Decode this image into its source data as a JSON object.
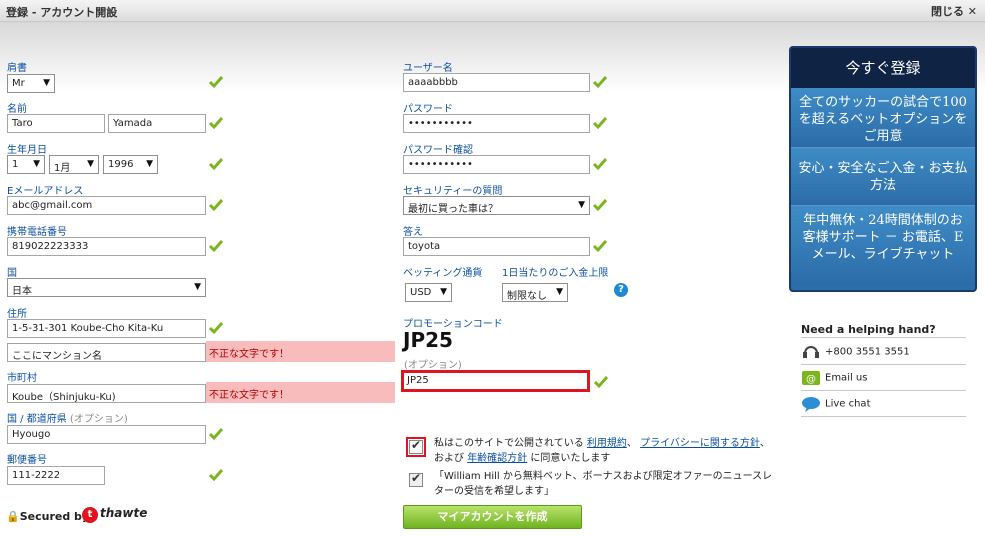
{
  "window": {
    "title": "登録 - アカウント開設",
    "close_label": "閉じる"
  },
  "colors": {
    "label": "#0b4fa3",
    "check": "#7ab51d",
    "error_bg": "#f9bcbc",
    "highlight": "#e0141e",
    "panel": "#2a6fa8"
  },
  "form": {
    "title_label": "肩書",
    "title_value": "Mr",
    "name_label": "名前",
    "first_name": "Taro",
    "last_name": "Yamada",
    "dob_label": "生年月日",
    "dob_day": "1",
    "dob_month": "1月",
    "dob_year": "1996",
    "email_label": "Eメールアドレス",
    "email": "abc@gmail.com",
    "mobile_label": "携帯電話番号",
    "mobile": "819022223333",
    "country_label": "国",
    "country": "日本",
    "address_label": "住所",
    "address1": "1-5-31-301 Koube-Cho Kita-Ku",
    "address2": "ここにマンション名",
    "address2_error": "不正な文字です！",
    "city_label": "市町村",
    "city": "Koube（Shinjuku-Ku)",
    "city_error": "不正な文字です！",
    "state_label": "国 / 都道府県",
    "state_optional": "(オプション)",
    "state": "Hyougo",
    "postcode_label": "郵便番号",
    "postcode": "111-2222",
    "username_label": "ユーザー名",
    "username": "aaaabbbb",
    "password_label": "パスワード",
    "password": "•••••••••••",
    "password_confirm_label": "パスワード確認",
    "password_confirm": "•••••••••••",
    "security_q_label": "セキュリティーの質問",
    "security_q": "最初に買った車は？",
    "answer_label": "答え",
    "answer": "toyota",
    "currency_label": "ベッティング通貨",
    "currency": "USD",
    "deposit_label": "1日当たりのご入金上限",
    "deposit": "制限なし",
    "help_icon": "?",
    "promo_label": "プロモーションコード",
    "promo_big": "JP25",
    "promo_optional": "(オプション)",
    "promo_value": "JP25",
    "terms_text_1": "私はこのサイトで公開されている",
    "terms_link_1": "利用規約",
    "terms_sep": "、",
    "terms_link_2": "プライバシーに関する方針",
    "terms_text_2": "、および",
    "terms_link_3": "年齢確認方針",
    "terms_text_3": "に同意いたします",
    "newsletter_text": "「William Hill から無料ベット、ボーナスおよび限定オファーのニュースレターの受信を希望します」",
    "submit_label": "マイアカウントを作成"
  },
  "footer": {
    "secured_label": "Secured by",
    "thawte_label": "thawte"
  },
  "panel": {
    "header": "今すぐ登録",
    "block1": "全てのサッカーの試合で100を超えるベットオプションをご用意",
    "block2": "安心・安全なご入金・お支払方法",
    "block3": "年中無休・24時間体制のお客様サポート － お電話、Eメール、ライブチャット"
  },
  "help": {
    "title": "Need a helping hand?",
    "phone": "+800 3551 3551",
    "email": "Email us",
    "chat": "Live chat"
  }
}
